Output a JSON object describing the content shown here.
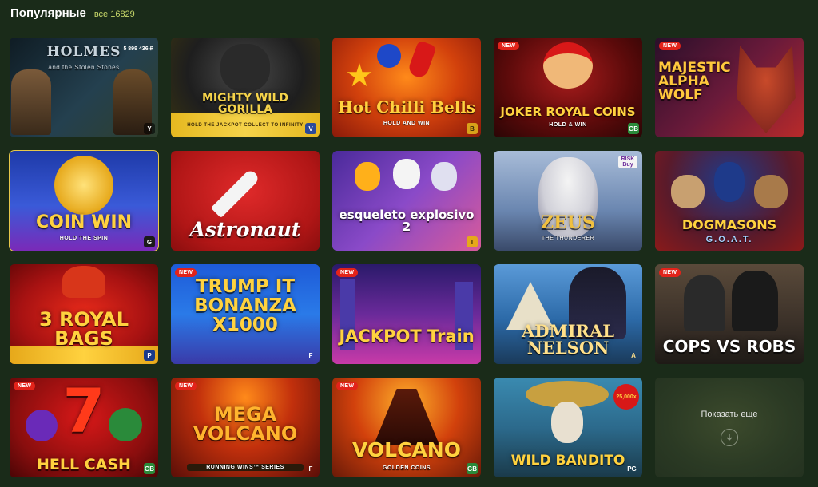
{
  "header": {
    "title": "Популярные",
    "all_link": "все 16829"
  },
  "games": [
    {
      "id": "holmes",
      "title": "HOLMES",
      "subtitle": "and the Stolen Stones",
      "overlay": "5 899 436 ₽",
      "new": false,
      "provider": "Y",
      "bg": "#1c2a33",
      "accent": "#b8c6d0"
    },
    {
      "id": "gorilla",
      "title": "MIGHTY WILD GORILLA",
      "subtitle": "HOLD THE JACKPOT COLLECT TO INFINITY",
      "new": false,
      "provider": "V",
      "bg": "#3b3a22",
      "accent": "#f2c230"
    },
    {
      "id": "chilli",
      "title": "Hot Chilli Bells",
      "subtitle": "HOLD AND WIN",
      "new": false,
      "provider": "B",
      "bg": "#c2410c",
      "accent": "#ffd23f"
    },
    {
      "id": "joker",
      "title": "JOKER ROYAL COINS",
      "subtitle": "HOLD & WIN",
      "new": true,
      "provider": "GB",
      "bg": "#7a1212",
      "accent": "#ffcf3a"
    },
    {
      "id": "wolf",
      "title": "MAJESTIC ALPHA WOLF",
      "subtitle": "",
      "new": true,
      "provider": "",
      "bg": "#4a1b33",
      "accent": "#ffc83d"
    },
    {
      "id": "coinwin",
      "title": "COIN WIN",
      "subtitle": "HOLD THE SPIN",
      "new": false,
      "provider": "G",
      "bg": "#1d3a8f",
      "accent": "#ffd23f"
    },
    {
      "id": "astronaut",
      "title": "Astronaut",
      "subtitle": "",
      "new": false,
      "provider": "",
      "bg": "#c21c1c",
      "accent": "#ffffff"
    },
    {
      "id": "esqueleto",
      "title": "esqueleto explosivo 2",
      "subtitle": "",
      "new": false,
      "provider": "T",
      "bg": "#6a3fb0",
      "accent": "#ffffff"
    },
    {
      "id": "zeus",
      "title": "ZEUS",
      "subtitle": "THE THUNDERER",
      "overlay": "RISK Buy",
      "new": false,
      "provider": "",
      "bg": "#8aa2c8",
      "accent": "#f0c040"
    },
    {
      "id": "dogmasons",
      "title": "DOGMASONS",
      "subtitle": "G.O.A.T.",
      "new": false,
      "provider": "",
      "bg": "#7a1d1d",
      "accent": "#ffd23f"
    },
    {
      "id": "royalbags",
      "title": "3 ROYAL BAGS",
      "subtitle": "",
      "new": false,
      "provider": "P",
      "bg": "#b31313",
      "accent": "#ffd23f"
    },
    {
      "id": "trump",
      "title": "TRUMP IT BONANZA X1000",
      "subtitle": "",
      "new": true,
      "provider": "F",
      "bg": "#1e5bd8",
      "accent": "#ffd23f"
    },
    {
      "id": "jackpot",
      "title": "JACKPOT Train",
      "subtitle": "",
      "new": true,
      "provider": "",
      "bg": "#4a2a8c",
      "accent": "#ffd23f"
    },
    {
      "id": "nelson",
      "title": "ADMIRAL NELSON",
      "subtitle": "",
      "new": false,
      "provider": "A",
      "bg": "#2c6aa8",
      "accent": "#ffe08a"
    },
    {
      "id": "cops",
      "title": "COPS VS ROBS",
      "subtitle": "",
      "new": true,
      "provider": "",
      "bg": "#3a3028",
      "accent": "#ffffff"
    },
    {
      "id": "hellcash",
      "title": "HELL CASH",
      "subtitle": "",
      "new": true,
      "provider": "GB",
      "bg": "#8a0e0e",
      "accent": "#ffd23f"
    },
    {
      "id": "megavolcano",
      "title": "MEGA VOLCANO",
      "subtitle": "RUNNING WINS™ SERIES",
      "new": true,
      "provider": "F",
      "bg": "#a2200c",
      "accent": "#ffb52e"
    },
    {
      "id": "volcano",
      "title": "VOLCANO",
      "subtitle": "GOLDEN COINS",
      "new": true,
      "provider": "GB",
      "bg": "#c23c0c",
      "accent": "#ffd23f"
    },
    {
      "id": "bandito",
      "title": "WILD BANDITO",
      "subtitle": "",
      "overlay": "25,000x",
      "new": false,
      "provider": "PG",
      "bg": "#2c6a8c",
      "accent": "#ffd23f"
    }
  ],
  "new_label": "NEW",
  "show_more": {
    "label": "Показать еще",
    "icon": "chevron-down-circle-icon"
  }
}
